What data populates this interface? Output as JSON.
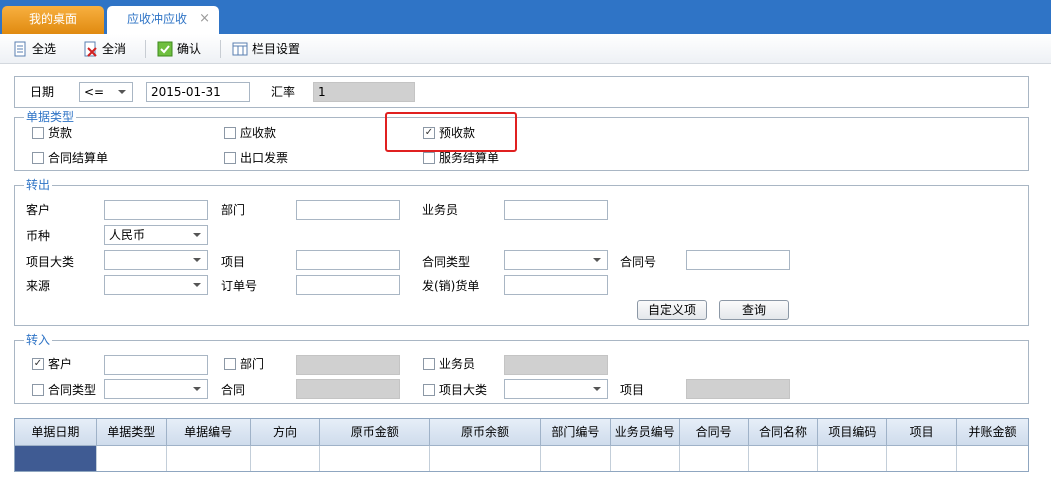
{
  "tabs": {
    "home": "我的桌面",
    "active": "应收冲应收",
    "close": "×"
  },
  "toolbar": {
    "select_all": "全选",
    "deselect_all": "全消",
    "confirm": "确认",
    "column_settings": "栏目设置"
  },
  "filter": {
    "date_label": "日期",
    "date_operator": "<=",
    "date_value": "2015-01-31",
    "rate_label": "汇率",
    "rate_value": "1"
  },
  "doc_type": {
    "legend": "单据类型",
    "options": [
      {
        "label": "货款",
        "checked": false
      },
      {
        "label": "应收款",
        "checked": false
      },
      {
        "label": "预收款",
        "checked": true
      },
      {
        "label": "合同结算单",
        "checked": false
      },
      {
        "label": "出口发票",
        "checked": false
      },
      {
        "label": "服务结算单",
        "checked": false
      }
    ]
  },
  "transfer_out": {
    "legend": "转出",
    "customer": "客户",
    "department": "部门",
    "salesperson": "业务员",
    "currency": "币种",
    "currency_value": "人民币",
    "project_category": "项目大类",
    "project": "项目",
    "contract_type": "合同类型",
    "contract_no": "合同号",
    "source": "来源",
    "order_no": "订单号",
    "delivery_doc": "发(销)货单",
    "custom_button": "自定义项",
    "query_button": "查询"
  },
  "transfer_in": {
    "legend": "转入",
    "customer": "客户",
    "customer_checked": true,
    "department": "部门",
    "salesperson": "业务员",
    "contract_type": "合同类型",
    "contract": "合同",
    "project_category": "项目大类",
    "project": "项目"
  },
  "grid": {
    "columns": [
      "单据日期",
      "单据类型",
      "单据编号",
      "方向",
      "原币金额",
      "原币余额",
      "部门编号",
      "业务员编号",
      "合同号",
      "合同名称",
      "项目编码",
      "项目",
      "并账金额"
    ]
  }
}
